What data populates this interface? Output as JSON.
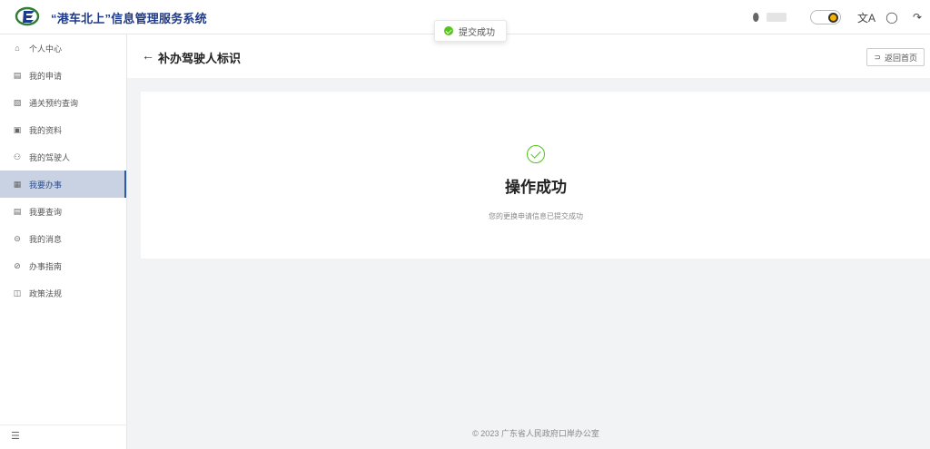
{
  "app": {
    "title": "“港车北上”信息管理服务系统",
    "brand_color": "#1e3a8a"
  },
  "toast": {
    "text": "提交成功",
    "status_color": "#52c41a"
  },
  "topbar": {
    "user_icon": "user-icon",
    "tools": [
      "theme-toggle",
      "translate-icon",
      "chat-icon",
      "logout-icon"
    ]
  },
  "sidebar": {
    "items": [
      {
        "label": "个人中心",
        "icon": "user-icon",
        "active": false
      },
      {
        "label": "我的申请",
        "icon": "document-icon",
        "active": false
      },
      {
        "label": "通关预约查询",
        "icon": "document-search-icon",
        "active": false
      },
      {
        "label": "我的资料",
        "icon": "id-card-icon",
        "active": false
      },
      {
        "label": "我的驾驶人",
        "icon": "driver-icon",
        "active": false
      },
      {
        "label": "我要办事",
        "icon": "task-icon",
        "active": true
      },
      {
        "label": "我要查询",
        "icon": "query-icon",
        "active": false
      },
      {
        "label": "我的消息",
        "icon": "message-icon",
        "active": false
      },
      {
        "label": "办事指南",
        "icon": "compass-icon",
        "active": false
      },
      {
        "label": "政策法规",
        "icon": "book-icon",
        "active": false
      }
    ],
    "active_color": "#c9d2e3"
  },
  "page": {
    "title": "补办驾驶人标识",
    "back_icon": "arrow-left-icon",
    "home_button": "返回首页"
  },
  "result": {
    "title": "操作成功",
    "subtitle": "您的更换申请信息已提交成功"
  },
  "footer": {
    "text": "© 2023 广东省人民政府口岸办公室"
  }
}
